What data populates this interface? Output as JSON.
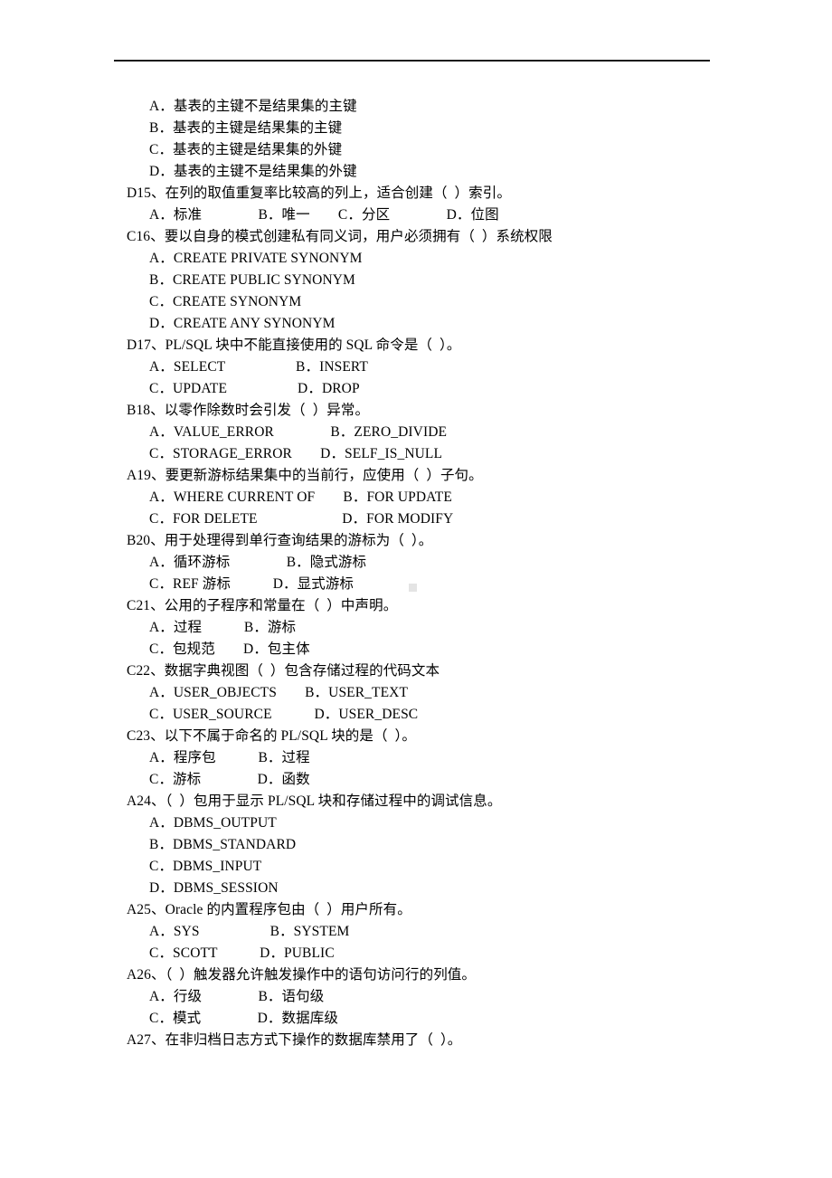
{
  "document": {
    "type": "exam-paper",
    "language": "zh-CN",
    "subject_hint": "Oracle PL/SQL multiple choice questions",
    "header_rule": true
  },
  "lines": [
    {
      "id": "l1",
      "kind": "option",
      "text": "A．基表的主键不是结果集的主键"
    },
    {
      "id": "l2",
      "kind": "option",
      "text": "B．基表的主键是结果集的主键"
    },
    {
      "id": "l3",
      "kind": "option",
      "text": "C．基表的主键是结果集的外键"
    },
    {
      "id": "l4",
      "kind": "option",
      "text": "D．基表的主键不是结果集的外键"
    },
    {
      "id": "l5",
      "kind": "question",
      "text": "D15、在列的取值重复率比较高的列上，适合创建（  ）索引。"
    },
    {
      "id": "l6",
      "kind": "option",
      "text": "A．标准　　　　B．唯一　　C．分区　　　　D．位图"
    },
    {
      "id": "l7",
      "kind": "question",
      "text": "C16、要以自身的模式创建私有同义词，用户必须拥有（  ）系统权限"
    },
    {
      "id": "l8",
      "kind": "option",
      "text": "A．CREATE PRIVATE SYNONYM"
    },
    {
      "id": "l9",
      "kind": "option",
      "text": "B．CREATE PUBLIC SYNONYM"
    },
    {
      "id": "l10",
      "kind": "option",
      "text": "C．CREATE SYNONYM"
    },
    {
      "id": "l11",
      "kind": "option",
      "text": "D．CREATE ANY SYNONYM"
    },
    {
      "id": "l12",
      "kind": "question",
      "text": "D17、PL/SQL 块中不能直接使用的 SQL 命令是（  ）。"
    },
    {
      "id": "l13",
      "kind": "option",
      "text": "A．SELECT　　　　　B．INSERT"
    },
    {
      "id": "l14",
      "kind": "option",
      "text": "C．UPDATE　　　　　D．DROP"
    },
    {
      "id": "l15",
      "kind": "question",
      "text": "B18、以零作除数时会引发（  ）异常。"
    },
    {
      "id": "l16",
      "kind": "option",
      "text": "A．VALUE_ERROR　　　　B．ZERO_DIVIDE"
    },
    {
      "id": "l17",
      "kind": "option",
      "text": "C．STORAGE_ERROR　　D．SELF_IS_NULL"
    },
    {
      "id": "l18",
      "kind": "question",
      "text": "A19、要更新游标结果集中的当前行，应使用（  ）子句。"
    },
    {
      "id": "l19",
      "kind": "option",
      "text": "A．WHERE CURRENT OF　　B．FOR UPDATE"
    },
    {
      "id": "l20",
      "kind": "option",
      "text": "C．FOR DELETE　　　　　　D．FOR MODIFY"
    },
    {
      "id": "l21",
      "kind": "question",
      "text": "B20、用于处理得到单行查询结果的游标为（  ）。"
    },
    {
      "id": "l22",
      "kind": "option",
      "text": "A．循环游标　　　　B．隐式游标"
    },
    {
      "id": "l23",
      "kind": "option",
      "text": "C．REF 游标　　　D．显式游标"
    },
    {
      "id": "l24",
      "kind": "question",
      "text": "C21、公用的子程序和常量在（  ）中声明。"
    },
    {
      "id": "l25",
      "kind": "option",
      "text": "A．过程　　　B．游标"
    },
    {
      "id": "l26",
      "kind": "option",
      "text": "C．包规范　　D．包主体"
    },
    {
      "id": "l27",
      "kind": "question",
      "text": "C22、数据字典视图（  ）包含存储过程的代码文本"
    },
    {
      "id": "l28",
      "kind": "option",
      "text": "A．USER_OBJECTS　　B．USER_TEXT"
    },
    {
      "id": "l29",
      "kind": "option",
      "text": "C．USER_SOURCE　　　D．USER_DESC"
    },
    {
      "id": "l30",
      "kind": "question",
      "text": "C23、以下不属于命名的 PL/SQL 块的是（  ）。"
    },
    {
      "id": "l31",
      "kind": "option",
      "text": "A．程序包　　　B．过程"
    },
    {
      "id": "l32",
      "kind": "option",
      "text": "C．游标　　　　D．函数"
    },
    {
      "id": "l33",
      "kind": "question",
      "text": "A24、（  ）包用于显示 PL/SQL 块和存储过程中的调试信息。"
    },
    {
      "id": "l34",
      "kind": "option",
      "text": "A．DBMS_OUTPUT"
    },
    {
      "id": "l35",
      "kind": "option",
      "text": "B．DBMS_STANDARD"
    },
    {
      "id": "l36",
      "kind": "option",
      "text": "C．DBMS_INPUT"
    },
    {
      "id": "l37",
      "kind": "option",
      "text": "D．DBMS_SESSION"
    },
    {
      "id": "l38",
      "kind": "question",
      "text": "A25、Oracle 的内置程序包由（  ）用户所有。"
    },
    {
      "id": "l39",
      "kind": "option",
      "text": "A．SYS　　　　　B．SYSTEM"
    },
    {
      "id": "l40",
      "kind": "option",
      "text": "C．SCOTT　　　D．PUBLIC"
    },
    {
      "id": "l41",
      "kind": "question",
      "text": "A26、（  ）触发器允许触发操作中的语句访问行的列值。"
    },
    {
      "id": "l42",
      "kind": "option",
      "text": "A．行级　　　　B．语句级"
    },
    {
      "id": "l43",
      "kind": "option",
      "text": "C．模式　　　　D．数据库级"
    },
    {
      "id": "l44",
      "kind": "question",
      "text": "A27、在非归档日志方式下操作的数据库禁用了（  ）。"
    }
  ]
}
